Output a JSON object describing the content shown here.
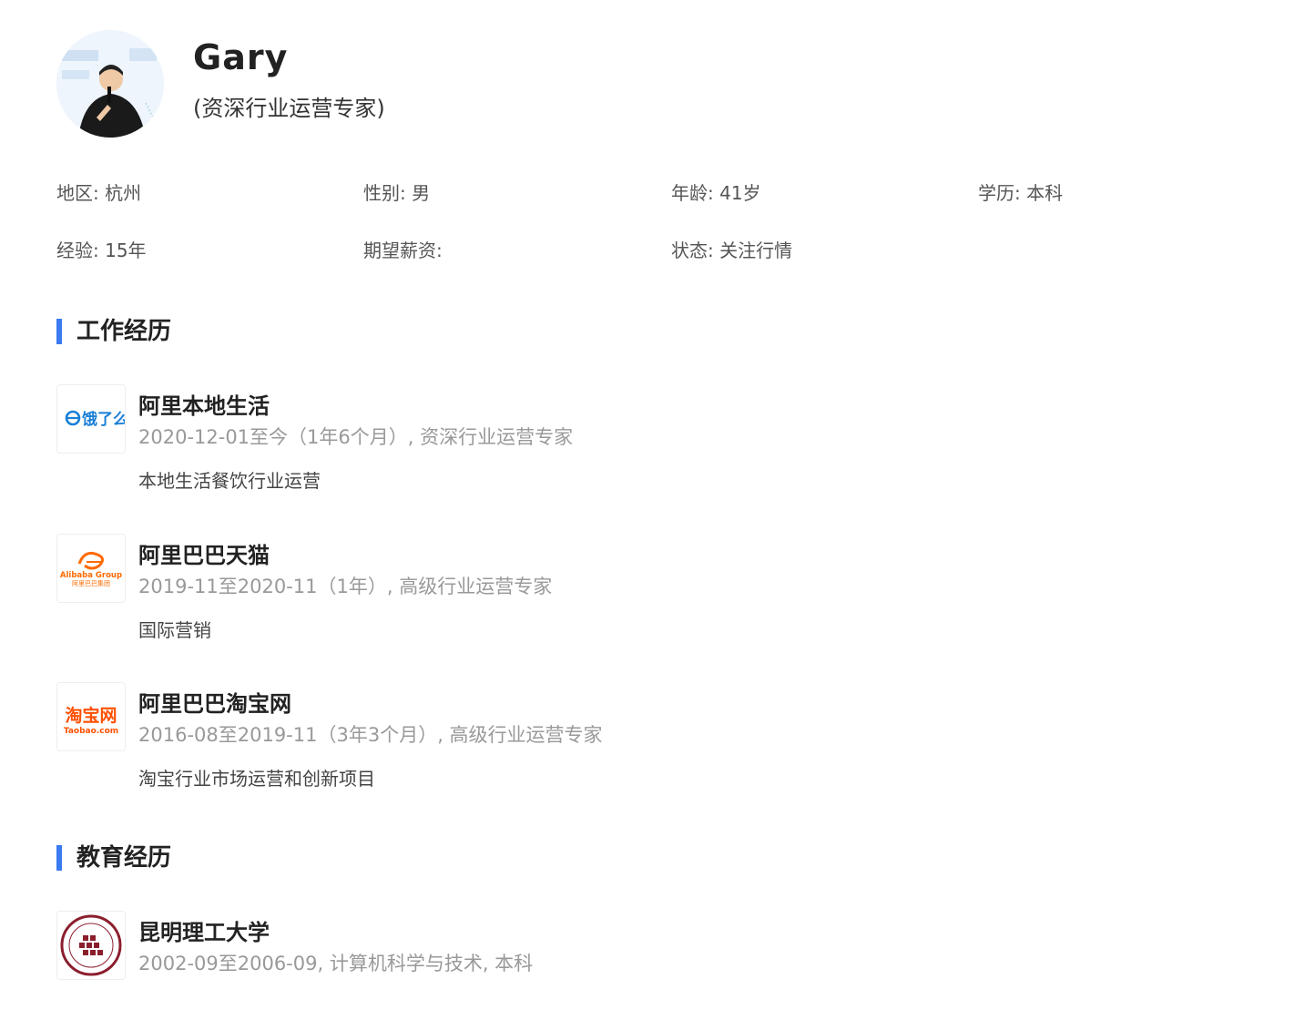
{
  "profile": {
    "name": "Gary",
    "title": "(资深行业运营专家)",
    "avatar_icon": "person-speaking-photo"
  },
  "info": {
    "region": "地区: 杭州",
    "gender": "性别: 男",
    "age": "年龄: 41岁",
    "education": "学历: 本科",
    "experience": "经验: 15年",
    "salary": "期望薪资:",
    "status": "状态: 关注行情"
  },
  "work": {
    "heading": "工作经历",
    "entries": [
      {
        "company": "阿里本地生活",
        "meta": "2020-12-01至今（1年6个月）, 资深行业运营专家",
        "desc": "本地生活餐饮行业运营",
        "logo_text": "饿了么",
        "logo_color": "#1a7fd6"
      },
      {
        "company": "阿里巴巴天猫",
        "meta": "2019-11至2020-11（1年）, 高级行业运营专家",
        "desc": "国际营销",
        "logo_text": "Alibaba Group",
        "logo_sub": "阿里巴巴集团",
        "logo_color": "#ff6a00"
      },
      {
        "company": "阿里巴巴淘宝网",
        "meta": "2016-08至2019-11（3年3个月）, 高级行业运营专家",
        "desc": "淘宝行业市场运营和创新项目",
        "logo_text": "淘宝网",
        "logo_sub": "Taobao.com",
        "logo_color": "#ff5000"
      }
    ]
  },
  "education": {
    "heading": "教育经历",
    "entries": [
      {
        "school": "昆明理工大学",
        "meta": "2002-09至2006-09, 计算机科学与技术, 本科",
        "logo_color": "#8b1e2d"
      }
    ]
  },
  "colors": {
    "accent": "#3a7bf0",
    "muted": "#999999",
    "text": "#333333"
  }
}
